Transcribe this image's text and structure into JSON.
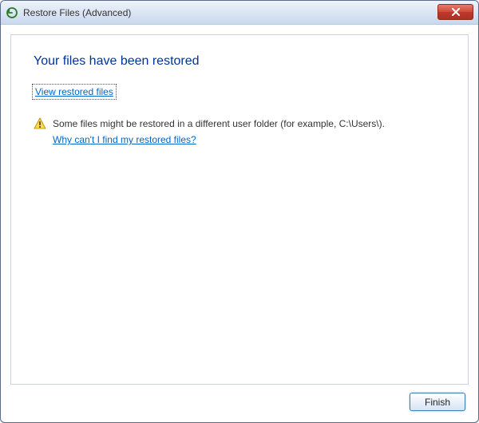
{
  "titlebar": {
    "title": "Restore Files (Advanced)"
  },
  "main": {
    "heading": "Your files have been restored",
    "view_link": "View restored files",
    "warning_text": "Some files might be restored in a different user folder (for example, C:\\Users\\).",
    "warning_help_link": "Why can't I find my restored files?"
  },
  "buttons": {
    "finish": "Finish"
  }
}
